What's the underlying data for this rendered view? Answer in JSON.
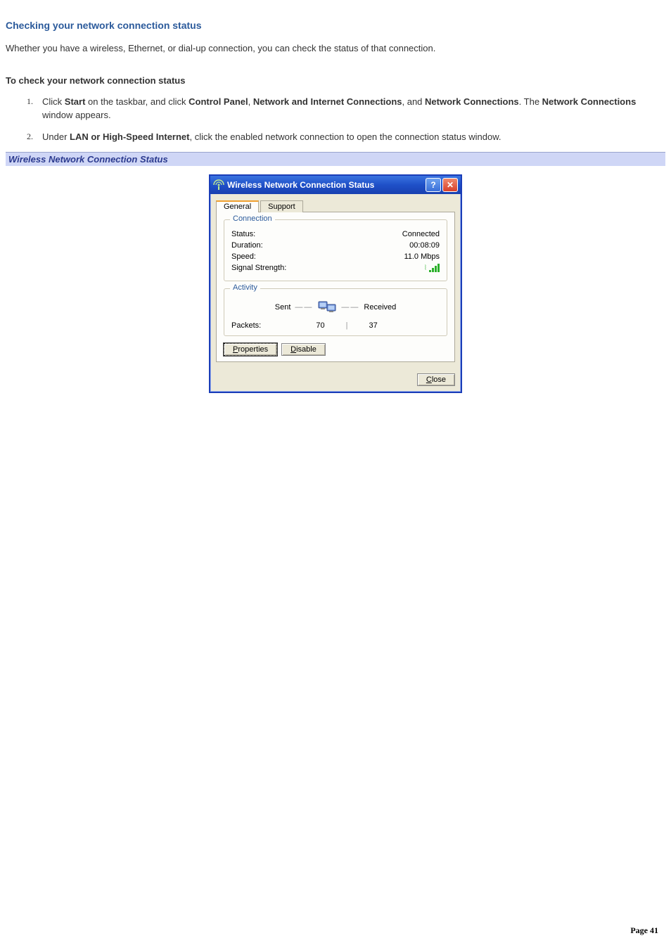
{
  "heading": "Checking your network connection status",
  "intro": "Whether you have a wireless, Ethernet, or dial-up connection, you can check the status of that connection.",
  "sub_heading": "To check your network connection status",
  "steps": {
    "1": {
      "prefix": "Click ",
      "b1": "Start",
      "t1": " on the taskbar, and click ",
      "b2": "Control Panel",
      "t2": ", ",
      "b3": "Network and Internet Connections",
      "t3": ", and ",
      "b4": "Network Connections",
      "t4": ". The ",
      "b5": "Network Connections",
      "t5": " window appears."
    },
    "2": {
      "prefix": "Under ",
      "b1": "LAN or High-Speed Internet",
      "t1": ", click the enabled network connection to open the connection status window."
    }
  },
  "caption": "Wireless Network Connection Status",
  "dialog": {
    "title": "Wireless Network Connection Status",
    "tabs": {
      "general": "General",
      "support": "Support"
    },
    "groups": {
      "connection": {
        "title": "Connection",
        "status_label": "Status:",
        "status_value": "Connected",
        "duration_label": "Duration:",
        "duration_value": "00:08:09",
        "speed_label": "Speed:",
        "speed_value": "11.0 Mbps",
        "signal_label": "Signal Strength:"
      },
      "activity": {
        "title": "Activity",
        "sent": "Sent",
        "received": "Received",
        "packets_label": "Packets:",
        "packets_sent": "70",
        "packets_received": "37"
      }
    },
    "buttons": {
      "properties": "Properties",
      "disable": "Disable",
      "close_rest": "lose"
    }
  },
  "footer": {
    "page_label": "Page",
    "page_number": "41"
  }
}
